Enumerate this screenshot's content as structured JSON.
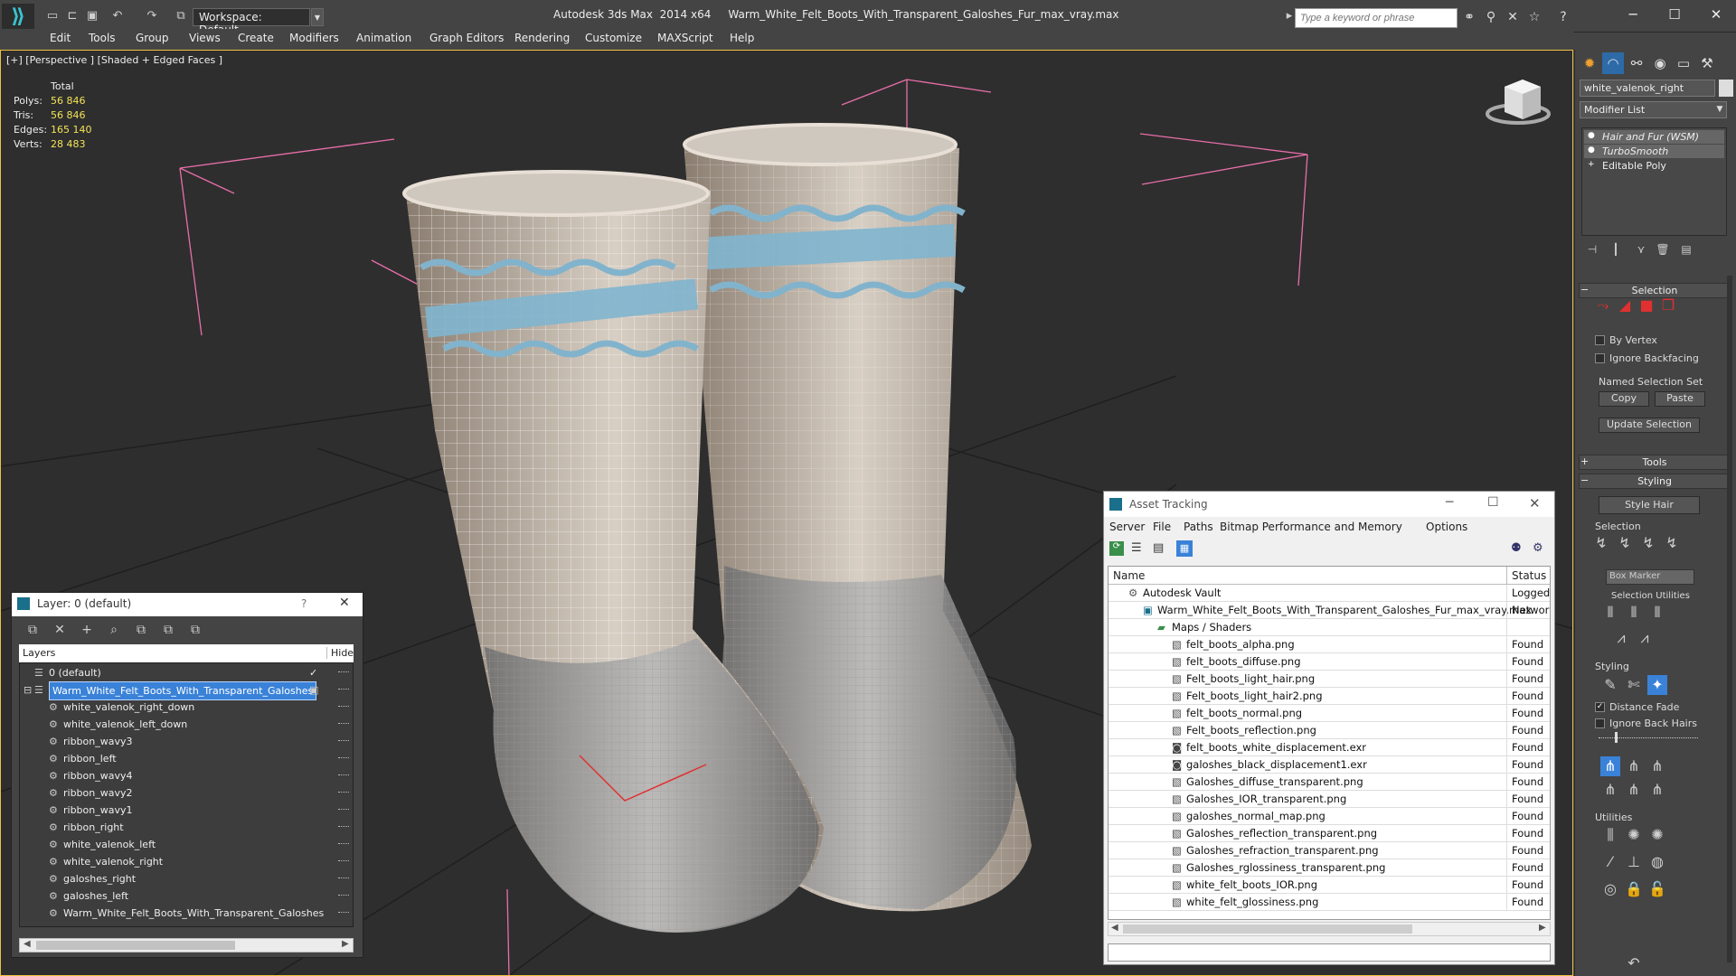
{
  "app": {
    "title": "Autodesk 3ds Max  2014 x64     Warm_White_Felt_Boots_With_Transparent_Galoshes_Fur_max_vray.max",
    "workspace": "Workspace: Default",
    "search_placeholder": "Type a keyword or phrase"
  },
  "menu": [
    "Edit",
    "Tools",
    "Group",
    "Views",
    "Create",
    "Modifiers",
    "Animation",
    "Graph Editors",
    "Rendering",
    "Customize",
    "MAXScript",
    "Help"
  ],
  "viewport": {
    "label": "[+] [Perspective ] [Shaded + Edged Faces ]",
    "stats": {
      "header": "Total",
      "rows": [
        {
          "label": "Polys:",
          "value": "56 846"
        },
        {
          "label": "Tris:",
          "value": "56 846"
        },
        {
          "label": "Edges:",
          "value": "165 140"
        },
        {
          "label": "Verts:",
          "value": "28 483"
        }
      ]
    }
  },
  "command_panel": {
    "object_name": "white_valenok_right",
    "modifier_list": "Modifier List",
    "stack": [
      "Hair and Fur (WSM)",
      "TurboSmooth",
      "Editable Poly"
    ],
    "selection": {
      "header": "Selection",
      "by_vertex": "By Vertex",
      "ignore_backfacing": "Ignore Backfacing",
      "named_selection_set": "Named Selection Set",
      "copy": "Copy",
      "paste": "Paste",
      "update_selection": "Update Selection"
    },
    "tools_header": "Tools",
    "styling": {
      "header": "Styling",
      "style_hair": "Style Hair",
      "selection_label": "Selection",
      "box_marker": "Box Marker",
      "selection_utilities": "Selection Utilities",
      "styling_label": "Styling",
      "distance_fade": "Distance Fade",
      "ignore_back_hairs": "Ignore Back Hairs",
      "utilities_label": "Utilities"
    }
  },
  "layer_dialog": {
    "title": "Layer: 0 (default)",
    "col_layers": "Layers",
    "col_hide": "Hide",
    "rows": [
      {
        "name": "0 (default)",
        "level": 0,
        "selected": false
      },
      {
        "name": "Warm_White_Felt_Boots_With_Transparent_Galoshes",
        "level": 0,
        "selected": true
      },
      {
        "name": "white_valenok_right_down",
        "level": 1,
        "selected": false
      },
      {
        "name": "white_valenok_left_down",
        "level": 1,
        "selected": false
      },
      {
        "name": "ribbon_wavy3",
        "level": 1,
        "selected": false
      },
      {
        "name": "ribbon_left",
        "level": 1,
        "selected": false
      },
      {
        "name": "ribbon_wavy4",
        "level": 1,
        "selected": false
      },
      {
        "name": "ribbon_wavy2",
        "level": 1,
        "selected": false
      },
      {
        "name": "ribbon_wavy1",
        "level": 1,
        "selected": false
      },
      {
        "name": "ribbon_right",
        "level": 1,
        "selected": false
      },
      {
        "name": "white_valenok_left",
        "level": 1,
        "selected": false
      },
      {
        "name": "white_valenok_right",
        "level": 1,
        "selected": false
      },
      {
        "name": "galoshes_right",
        "level": 1,
        "selected": false
      },
      {
        "name": "galoshes_left",
        "level": 1,
        "selected": false
      },
      {
        "name": "Warm_White_Felt_Boots_With_Transparent_Galoshes",
        "level": 1,
        "selected": false
      }
    ]
  },
  "asset_dialog": {
    "title": "Asset Tracking",
    "menu": [
      "Server",
      "File",
      "Paths",
      "Bitmap Performance and Memory",
      "Options"
    ],
    "col_name": "Name",
    "col_status": "Status",
    "rows": [
      {
        "name": "Autodesk Vault",
        "status": "Logged O",
        "level": 0
      },
      {
        "name": "Warm_White_Felt_Boots_With_Transparent_Galoshes_Fur_max_vray.max",
        "status": "Network",
        "level": 1
      },
      {
        "name": "Maps / Shaders",
        "status": "",
        "level": 2
      },
      {
        "name": "felt_boots_alpha.png",
        "status": "Found",
        "level": 3
      },
      {
        "name": "felt_boots_diffuse.png",
        "status": "Found",
        "level": 3
      },
      {
        "name": "Felt_boots_light_hair.png",
        "status": "Found",
        "level": 3
      },
      {
        "name": "Felt_boots_light_hair2.png",
        "status": "Found",
        "level": 3
      },
      {
        "name": "felt_boots_normal.png",
        "status": "Found",
        "level": 3
      },
      {
        "name": "Felt_boots_reflection.png",
        "status": "Found",
        "level": 3
      },
      {
        "name": "felt_boots_white_displacement.exr",
        "status": "Found",
        "level": 3
      },
      {
        "name": "galoshes_black_displacement1.exr",
        "status": "Found",
        "level": 3
      },
      {
        "name": "Galoshes_diffuse_transparent.png",
        "status": "Found",
        "level": 3
      },
      {
        "name": "Galoshes_IOR_transparent.png",
        "status": "Found",
        "level": 3
      },
      {
        "name": "galoshes_normal_map.png",
        "status": "Found",
        "level": 3
      },
      {
        "name": "Galoshes_reflection_transparent.png",
        "status": "Found",
        "level": 3
      },
      {
        "name": "Galoshes_refraction_transparent.png",
        "status": "Found",
        "level": 3
      },
      {
        "name": "Galoshes_rglossiness_transparent.png",
        "status": "Found",
        "level": 3
      },
      {
        "name": "white_felt_boots_IOR.png",
        "status": "Found",
        "level": 3
      },
      {
        "name": "white_felt_glossiness.png",
        "status": "Found",
        "level": 3
      }
    ]
  }
}
